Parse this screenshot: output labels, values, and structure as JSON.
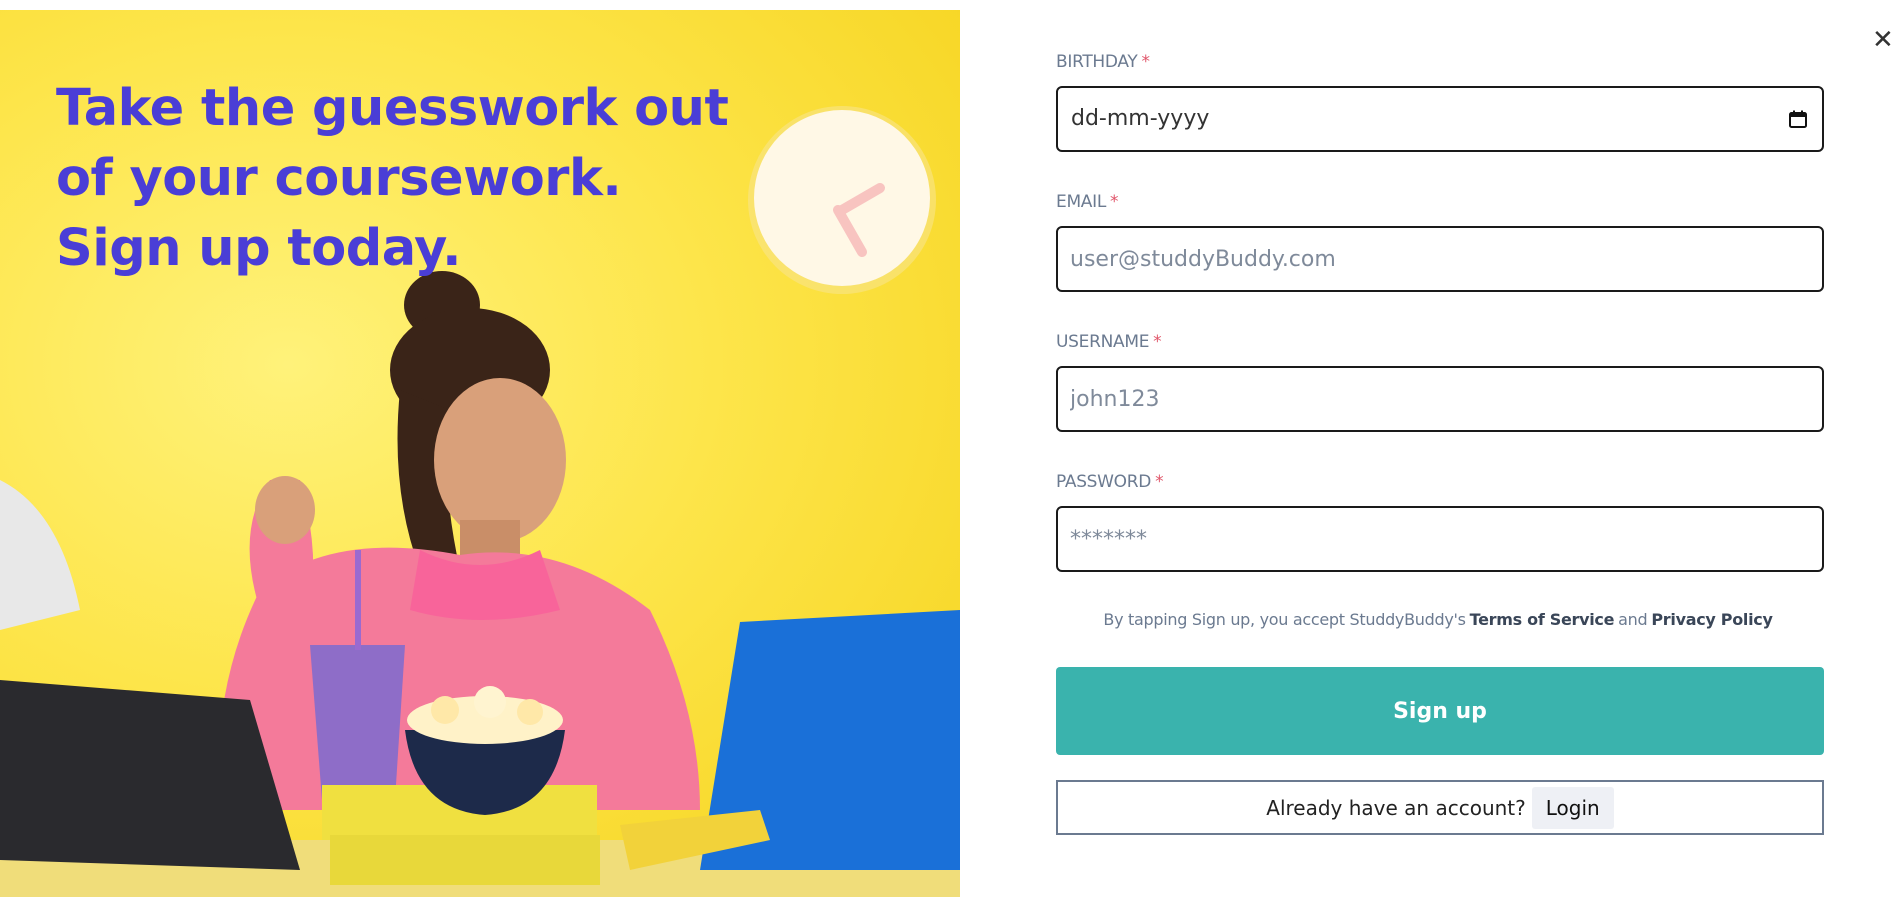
{
  "hero": {
    "headline_lines": [
      "Take the guesswork out",
      "of your coursework.",
      "Sign up today."
    ]
  },
  "close": {
    "glyph": "✕"
  },
  "form": {
    "birthday": {
      "label": "BIRTHDAY",
      "required_mark": "*",
      "value_display": "dd-mm-yyyy"
    },
    "email": {
      "label": "EMAIL",
      "required_mark": "*",
      "placeholder": "user@studdyBuddy.com"
    },
    "username": {
      "label": "USERNAME",
      "required_mark": "*",
      "placeholder": "john123"
    },
    "password": {
      "label": "PASSWORD",
      "required_mark": "*",
      "placeholder": "*******"
    },
    "terms": {
      "prefix": "By tapping Sign up, you accept StuddyBuddy's",
      "terms_link": "Terms of Service",
      "conjunction": "and",
      "privacy_link": "Privacy Policy"
    },
    "signup_label": "Sign up",
    "login_prompt": "Already have an account?",
    "login_label": "Login"
  },
  "colors": {
    "headline": "#4a3ed6",
    "signup_button": "#3ab3ad",
    "required": "#e0566a",
    "label": "#6b7a90"
  },
  "icons": {
    "calendar": "calendar-icon",
    "close": "close-icon"
  }
}
